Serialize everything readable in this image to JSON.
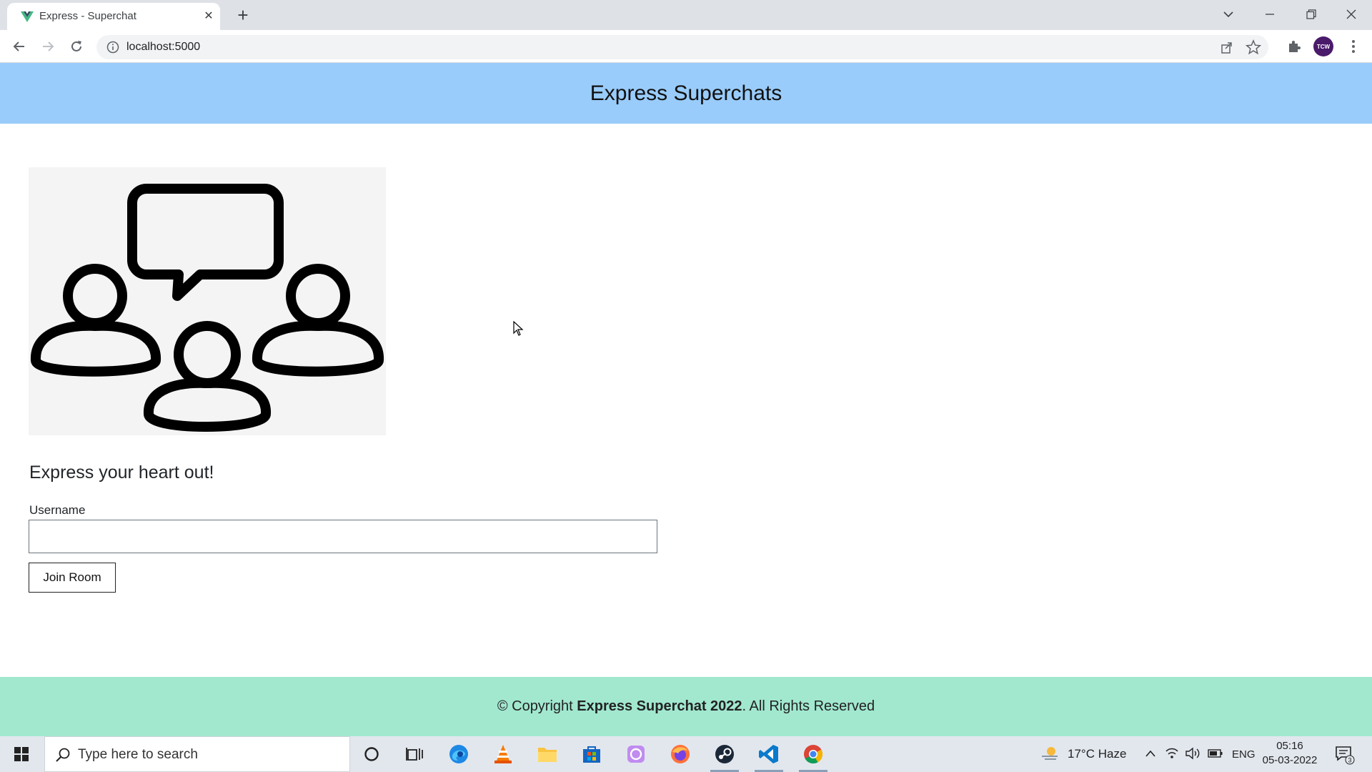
{
  "browser": {
    "tab_title": "Express - Superchat",
    "url": "localhost:5000",
    "avatar_text": "TCW"
  },
  "page": {
    "header_title": "Express Superchats",
    "tagline": "Express your heart out!",
    "username_label": "Username",
    "username_value": "",
    "join_button": "Join Room",
    "footer_prefix": "© Copyright ",
    "footer_brand": "Express Superchat 2022",
    "footer_suffix": ". All Rights Reserved"
  },
  "taskbar": {
    "search_placeholder": "Type here to search",
    "weather": "17°C  Haze",
    "language": "ENG",
    "time": "05:16",
    "date": "05-03-2022",
    "notification_count": "3"
  },
  "colors": {
    "header_bg": "#99ccfb",
    "footer_bg": "#a1e8cf"
  }
}
